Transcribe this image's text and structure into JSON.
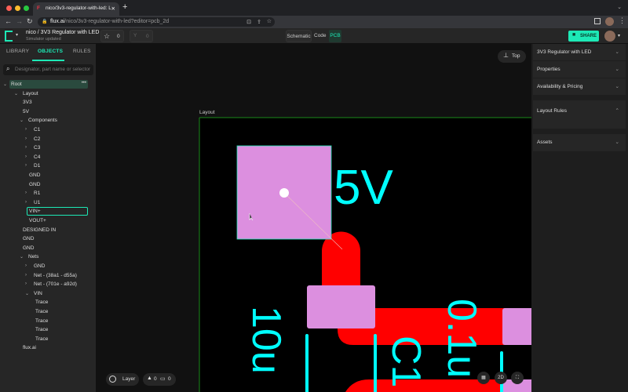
{
  "browser": {
    "tab_title": "nico/3v3-regulator-with-led: L",
    "url_domain": "flux.ai",
    "url_path": "/nico/3v3-regulator-with-led?editor=pcb_2d",
    "new_tab": "+"
  },
  "app": {
    "project_path": "nico / 3V3 Regulator with LED",
    "status": "Simulator updated",
    "star_count": "0",
    "fork_count": "0",
    "views": [
      "Schematic",
      "Code",
      "PCB"
    ],
    "active_view": "PCB",
    "share_label": "SHARE"
  },
  "left_panel": {
    "tabs": [
      "LIBRARY",
      "OBJECTS",
      "RULES"
    ],
    "active_tab": "OBJECTS",
    "search_placeholder": "Designator, part name or selector",
    "tree": [
      {
        "label": "Root",
        "level": 0,
        "chevron": "down",
        "selected": true,
        "menu": "•••"
      },
      {
        "label": "Layout",
        "level": 1,
        "chevron": "down"
      },
      {
        "label": "3V3",
        "level": 2
      },
      {
        "label": "5V",
        "level": 2
      },
      {
        "label": "Components",
        "level": 2,
        "chevron": "down"
      },
      {
        "label": "C1",
        "level": 3,
        "chevron": "right"
      },
      {
        "label": "C2",
        "level": 3,
        "chevron": "right"
      },
      {
        "label": "C3",
        "level": 3,
        "chevron": "right"
      },
      {
        "label": "C4",
        "level": 3,
        "chevron": "right"
      },
      {
        "label": "D1",
        "level": 3,
        "chevron": "right"
      },
      {
        "label": "GND",
        "level": 3
      },
      {
        "label": "GND",
        "level": 3
      },
      {
        "label": "R1",
        "level": 3,
        "chevron": "right"
      },
      {
        "label": "U1",
        "level": 3,
        "chevron": "right"
      },
      {
        "label": "VIN+",
        "level": 3,
        "focused": true
      },
      {
        "label": "VOUT+",
        "level": 3
      },
      {
        "label": "DESIGNED IN",
        "level": 2
      },
      {
        "label": "GND",
        "level": 2
      },
      {
        "label": "GND",
        "level": 2
      },
      {
        "label": "Nets",
        "level": 2,
        "chevron": "down"
      },
      {
        "label": "GND",
        "level": 3,
        "chevron": "right"
      },
      {
        "label": "Net - (38a1 - d55a)",
        "level": 3,
        "chevron": "right"
      },
      {
        "label": "Net - (701e - a92d)",
        "level": 3,
        "chevron": "right"
      },
      {
        "label": "VIN",
        "level": 3,
        "chevron": "down"
      },
      {
        "label": "Trace",
        "level": 4
      },
      {
        "label": "Trace",
        "level": 4
      },
      {
        "label": "Trace",
        "level": 4
      },
      {
        "label": "Trace",
        "level": 4
      },
      {
        "label": "Trace",
        "level": 4
      },
      {
        "label": "flux.ai",
        "level": 2
      }
    ]
  },
  "canvas": {
    "layer_side": "Top",
    "board_label": "Layout",
    "silk_texts": [
      "5V",
      "10u",
      "C1",
      "0.1u"
    ],
    "layer_label": "Layer",
    "warnings": "0",
    "comments": "0",
    "view_mode": "2D"
  },
  "right_panel": {
    "sections": [
      {
        "label": "3V3 Regulator with LED",
        "state": "collapsed"
      },
      {
        "label": "Properties",
        "state": "collapsed"
      },
      {
        "label": "Availability & Pricing",
        "state": "collapsed"
      },
      {
        "label": "Layout Rules",
        "state": "expanded"
      },
      {
        "label": "Assets",
        "state": "collapsed"
      }
    ]
  },
  "colors": {
    "accent": "#1de9b6",
    "pad": "#dc8fdf",
    "trace": "#ff0000",
    "silk": "#00ffff",
    "board_outline": "#1a8a1a"
  }
}
